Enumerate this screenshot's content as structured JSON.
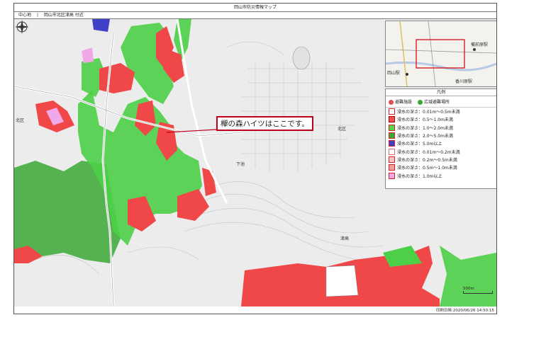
{
  "header": {
    "title": "岡山市防災情報マップ",
    "location_label": "中心地",
    "location_value": "岡山市北区津高 付近",
    "print_date": "印刷日時:2020/06/26 14:50:15"
  },
  "callout": {
    "text": "欅の森ハイツはここです。"
  },
  "map_labels": {
    "kita_ku_left": "北区",
    "kita_ku_center": "北区",
    "shimo_ike": "下池",
    "tsutaka": "津高"
  },
  "inset": {
    "okayama_station": "岡山駅",
    "bizen_station": "備前原駅",
    "kagawa_station": "香川原駅"
  },
  "scale": {
    "label": "500m"
  },
  "legend": {
    "title": "凡例",
    "shelter": "避難施設",
    "wide_area": "広域避難場所",
    "items": [
      {
        "label": "浸水の深さ：0.01m〜0.5m未満",
        "color": "#ffffff",
        "border": "#d22222"
      },
      {
        "label": "浸水の深さ：0.5〜1.0m未満",
        "color": "#f25151",
        "border": "#b00000"
      },
      {
        "label": "浸水の深さ：1.0〜2.0m未満",
        "color": "#56d64a",
        "border": "#d22222"
      },
      {
        "label": "浸水の深さ：2.0〜5.0m未満",
        "color": "#3aa836",
        "border": "#d22222"
      },
      {
        "label": "浸水の深さ：5.0m以上",
        "color": "#4040c8",
        "border": "#d22222"
      },
      {
        "label": "浸水の深さ：0.01m〜0.2m未満",
        "color": "#ffffff",
        "border": "#e07070"
      },
      {
        "label": "浸水の深さ：0.2m〜0.5m未満",
        "color": "#f8c8c8",
        "border": "#d22222"
      },
      {
        "label": "浸水の深さ：0.5m〜1.0m未満",
        "color": "#f0a0a0",
        "border": "#d22222"
      },
      {
        "label": "浸水の深さ：1.0m以上",
        "color": "#f0a8e8",
        "border": "#d22222"
      }
    ]
  },
  "colors": {
    "flood_red": "#f04848",
    "flood_green": "#4cd048",
    "flood_dark_green": "#3aa836",
    "flood_blue": "#4040c8",
    "flood_pink": "#f0a8e8",
    "callout_border": "#c0001a"
  },
  "icons": [
    "compass-icon",
    "shelter-icon",
    "wide-area-icon"
  ]
}
